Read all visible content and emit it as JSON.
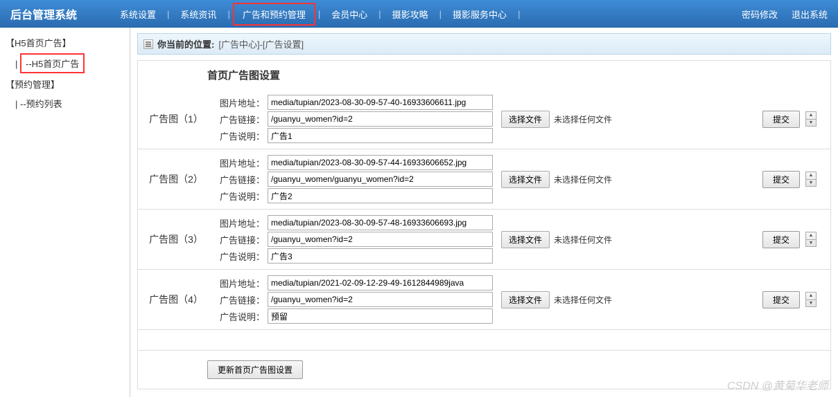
{
  "header": {
    "title": "后台管理系统",
    "nav": [
      "系统设置",
      "系统资讯",
      "广告和预约管理",
      "会员中心",
      "摄影攻略",
      "摄影服务中心"
    ],
    "nav_highlight_index": 2,
    "right": [
      "密码修改",
      "退出系统"
    ]
  },
  "sidebar": {
    "groups": [
      {
        "title": "【H5首页广告】",
        "items": [
          {
            "label": "--H5首页广告",
            "active": true
          }
        ]
      },
      {
        "title": "【预约管理】",
        "items": [
          {
            "label": "| --预约列表",
            "active": false
          }
        ]
      }
    ]
  },
  "breadcrumb": {
    "label": "你当前的位置:",
    "path": "[广告中心]-[广告设置]"
  },
  "page_subtitle": "首页广告图设置",
  "field_labels": {
    "image": "图片地址：",
    "link": "广告链接：",
    "desc": "广告说明："
  },
  "file_button": "选择文件",
  "file_none": "未选择任何文件",
  "submit_label": "提交",
  "update_label": "更新首页广告图设置",
  "ads": [
    {
      "title": "广告图（1）",
      "image": "media/tupian/2023-08-30-09-57-40-16933606611.jpg",
      "link": "/guanyu_women?id=2",
      "desc": "广告1"
    },
    {
      "title": "广告图（2）",
      "image": "media/tupian/2023-08-30-09-57-44-16933606652.jpg",
      "link": "/guanyu_women/guanyu_women?id=2",
      "desc": "广告2"
    },
    {
      "title": "广告图（3）",
      "image": "media/tupian/2023-08-30-09-57-48-16933606693.jpg",
      "link": "/guanyu_women?id=2",
      "desc": "广告3"
    },
    {
      "title": "广告图（4）",
      "image": "media/tupian/2021-02-09-12-29-49-1612844989java",
      "link": "/guanyu_women?id=2",
      "desc": "预留"
    }
  ],
  "watermark": "CSDN @黄菊华老师"
}
